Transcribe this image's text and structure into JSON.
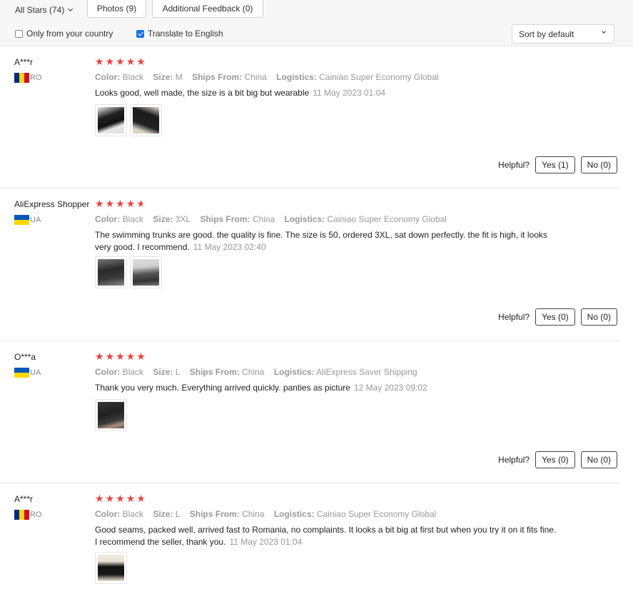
{
  "filters": {
    "stars_label": "All Stars (74)",
    "photos_label": "Photos (9)",
    "additional_label": "Additional Feedback (0)",
    "only_country_label": "Only from your country",
    "only_country_checked": false,
    "translate_label": "Translate to English",
    "translate_checked": true,
    "sort_label": "Sort by default"
  },
  "attr_labels": {
    "color": "Color:",
    "size": "Size:",
    "ships_from": "Ships From:",
    "logistics": "Logistics:"
  },
  "helpful_label": "Helpful?",
  "colors": {
    "star": "#e94141",
    "checkbox_accent": "#1a73e8"
  },
  "reviews": [
    {
      "reviewer": "A***r",
      "country": "RO",
      "rating": 5,
      "color": "Black",
      "size": "M",
      "ships_from": "China",
      "logistics": "Cainiao Super Economy Global",
      "text": "Looks good, well made, the size is a bit big but wearable",
      "date": "11 May 2023 01:04",
      "photos": 2,
      "yes_label": "Yes (1)",
      "no_label": "No (0)"
    },
    {
      "reviewer": "AliExpress Shopper",
      "country": "UA",
      "rating": 4.7,
      "color": "Black",
      "size": "3XL",
      "ships_from": "China",
      "logistics": "Cainiao Super Economy Global",
      "text": "The swimming trunks are good. the quality is fine. The size is 50, ordered 3XL, sat down perfectly. the fit is high, it looks very good. I recommend.",
      "date": "11 May 2023 02:40",
      "photos": 2,
      "yes_label": "Yes (0)",
      "no_label": "No (0)"
    },
    {
      "reviewer": "O***a",
      "country": "UA",
      "rating": 5,
      "color": "Black",
      "size": "L",
      "ships_from": "China",
      "logistics": "AliExpress Saver Shipping",
      "text": "Thank you very much. Everything arrived quickly. panties as picture",
      "date": "12 May 2023 09:02",
      "photos": 1,
      "yes_label": "Yes (0)",
      "no_label": "No (0)"
    },
    {
      "reviewer": "A***r",
      "country": "RO",
      "rating": 5,
      "color": "Black",
      "size": "L",
      "ships_from": "China",
      "logistics": "Cainiao Super Economy Global",
      "text": "Good seams, packed well, arrived fast to Romania, no complaints. It looks a bit big at first but when you try it on it fits fine. I recommend the seller, thank you.",
      "date": "11 May 2023 01:04",
      "photos": 1
    }
  ]
}
